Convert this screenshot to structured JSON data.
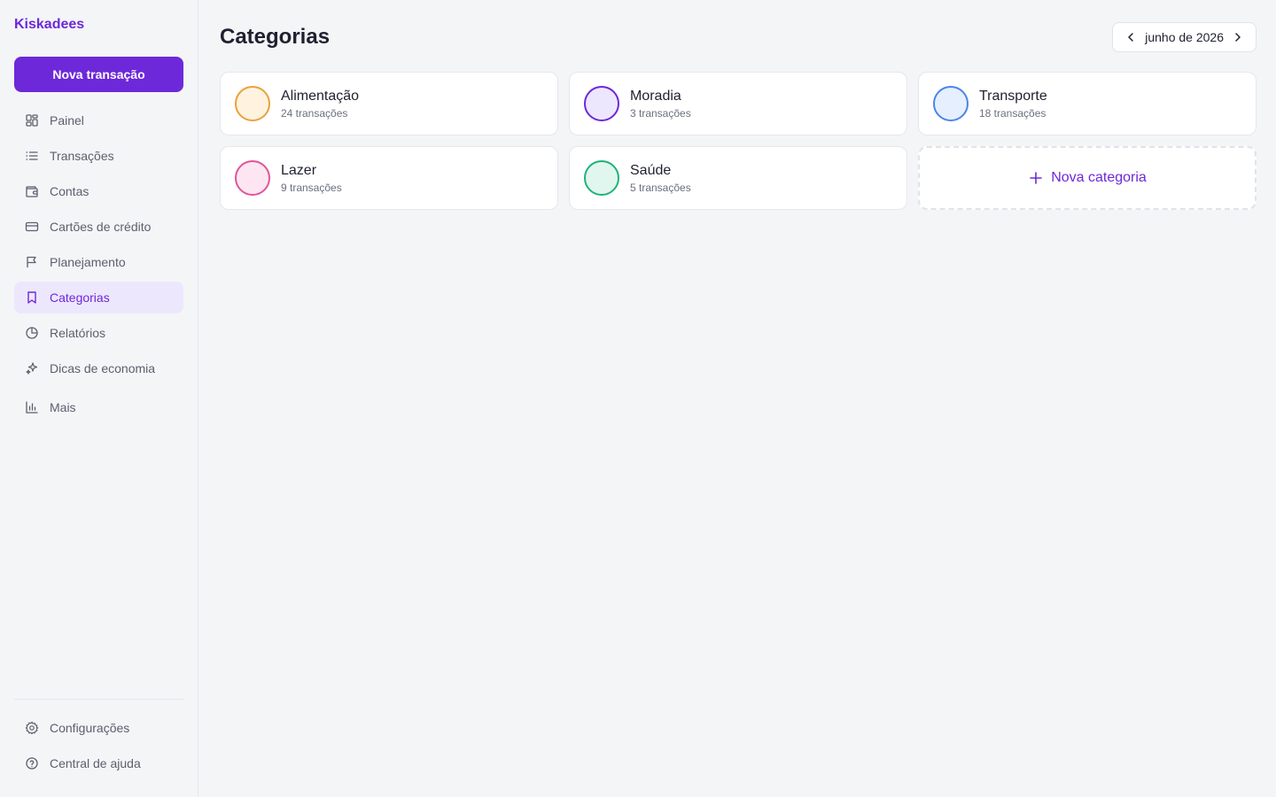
{
  "app": {
    "brand": "Kiskadees"
  },
  "sidebar": {
    "new_transaction_label": "Nova transação",
    "items": [
      {
        "label": "Painel",
        "icon": "dashboard-icon"
      },
      {
        "label": "Transações",
        "icon": "list-icon"
      },
      {
        "label": "Contas",
        "icon": "wallet-icon"
      },
      {
        "label": "Cartões de crédito",
        "icon": "credit-card-icon"
      },
      {
        "label": "Planejamento",
        "icon": "flag-icon"
      },
      {
        "label": "Categorias",
        "icon": "bookmark-icon",
        "active": true
      },
      {
        "label": "Relatórios",
        "icon": "pie-chart-icon"
      },
      {
        "label": "Dicas de economia",
        "icon": "sparkles-icon"
      },
      {
        "label": "Mais",
        "icon": "bar-chart-icon"
      }
    ],
    "footer_items": [
      {
        "label": "Configurações",
        "icon": "gear-icon"
      },
      {
        "label": "Central de ajuda",
        "icon": "help-icon"
      }
    ]
  },
  "main": {
    "title": "Categorias",
    "month": "junho de 2026",
    "categories": [
      {
        "name": "Alimentação",
        "count": "24 transações",
        "border": "#e9a23b",
        "fill": "#fff3e0"
      },
      {
        "name": "Moradia",
        "count": "3 transações",
        "border": "#6d28d9",
        "fill": "#ede7fe"
      },
      {
        "name": "Transporte",
        "count": "18 transações",
        "border": "#4a86e8",
        "fill": "#e6effd"
      },
      {
        "name": "Lazer",
        "count": "9 transações",
        "border": "#e0559a",
        "fill": "#fde6f1"
      },
      {
        "name": "Saúde",
        "count": "5 transações",
        "border": "#1fb27a",
        "fill": "#e1f6ee"
      }
    ],
    "new_category_label": "Nova categoria"
  },
  "colors": {
    "accent": "#6d28d9",
    "active_bg": "#ede7fe",
    "background": "#f4f5f7"
  }
}
